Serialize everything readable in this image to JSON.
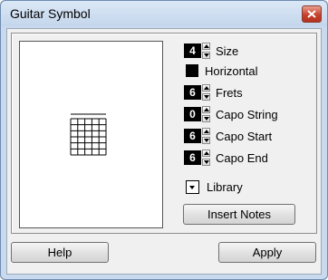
{
  "window": {
    "title": "Guitar Symbol"
  },
  "chord": {
    "strings": 6,
    "frets": 6
  },
  "controls": {
    "size": {
      "value": "4",
      "label": "Size"
    },
    "horizontal": {
      "label": "Horizontal",
      "checked": true
    },
    "frets": {
      "value": "6",
      "label": "Frets"
    },
    "capo_string": {
      "value": "0",
      "label": "Capo String"
    },
    "capo_start": {
      "value": "6",
      "label": "Capo Start"
    },
    "capo_end": {
      "value": "6",
      "label": "Capo End"
    },
    "library": {
      "label": "Library"
    },
    "insert_notes": {
      "label": "Insert Notes"
    }
  },
  "buttons": {
    "help": "Help",
    "apply": "Apply"
  }
}
